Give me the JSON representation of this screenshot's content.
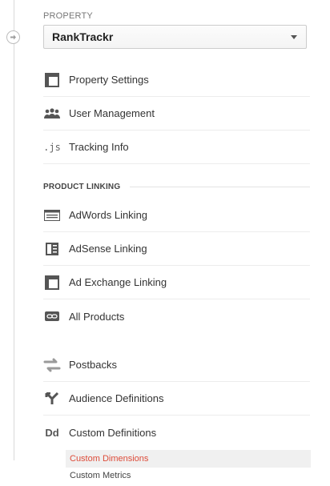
{
  "property": {
    "section_label": "PROPERTY",
    "selected": "RankTrackr"
  },
  "property_items": [
    {
      "label": "Property Settings",
      "icon": "property-settings-icon"
    },
    {
      "label": "User Management",
      "icon": "users-icon"
    },
    {
      "label": "Tracking Info",
      "icon": "js-icon"
    }
  ],
  "product_linking": {
    "section_label": "PRODUCT LINKING",
    "items": [
      {
        "label": "AdWords Linking",
        "icon": "adwords-icon"
      },
      {
        "label": "AdSense Linking",
        "icon": "adsense-icon"
      },
      {
        "label": "Ad Exchange Linking",
        "icon": "ad-exchange-icon"
      },
      {
        "label": "All Products",
        "icon": "link-icon"
      }
    ]
  },
  "other_items": [
    {
      "label": "Postbacks",
      "icon": "postbacks-icon"
    },
    {
      "label": "Audience Definitions",
      "icon": "audience-icon"
    },
    {
      "label": "Custom Definitions",
      "icon": "custom-definitions-icon"
    }
  ],
  "custom_definitions": [
    {
      "label": "Custom Dimensions",
      "active": true
    },
    {
      "label": "Custom Metrics",
      "active": false
    }
  ],
  "colors": {
    "active_text": "#dd4b39",
    "active_bg": "#f0f0f0",
    "icon": "#555555"
  }
}
